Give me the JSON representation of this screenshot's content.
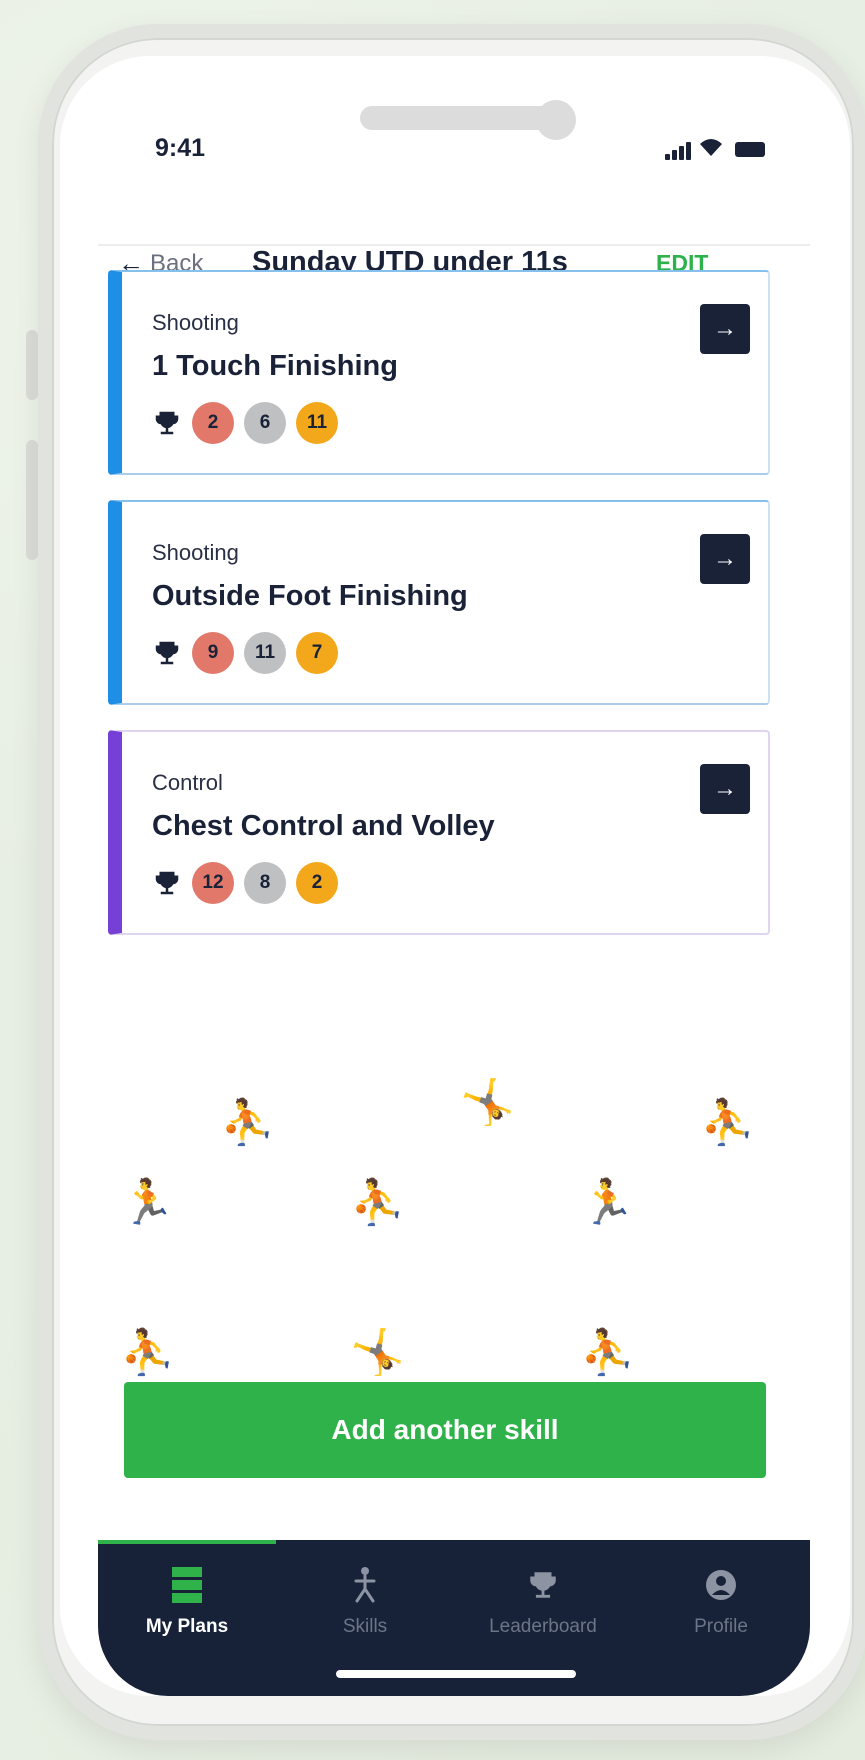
{
  "status_bar": {
    "time": "9:41"
  },
  "header": {
    "back_label": "Back",
    "title": "Sunday UTD under 11s",
    "edit_label": "EDIT"
  },
  "skills": [
    {
      "category": "Shooting",
      "name": "1 Touch Finishing",
      "badges": [
        "2",
        "6",
        "11"
      ],
      "accent": "#1f8fe6"
    },
    {
      "category": "Shooting",
      "name": "Outside Foot Finishing",
      "badges": [
        "9",
        "11",
        "7"
      ],
      "accent": "#1f8fe6"
    },
    {
      "category": "Control",
      "name": "Chest Control and Volley",
      "badges": [
        "12",
        "8",
        "2"
      ],
      "accent": "#7640d6"
    }
  ],
  "cta": {
    "label": "Add another skill"
  },
  "tabs": [
    {
      "label": "My Plans",
      "icon": "plans-icon",
      "active": true
    },
    {
      "label": "Skills",
      "icon": "skills-icon",
      "active": false
    },
    {
      "label": "Leaderboard",
      "icon": "trophy-icon",
      "active": false
    },
    {
      "label": "Profile",
      "icon": "profile-icon",
      "active": false
    }
  ],
  "colors": {
    "primary_green": "#2fb24a",
    "navy": "#172238",
    "badge_red": "#e2786a",
    "badge_grey": "#bfc0c2",
    "badge_gold": "#f3a81c"
  }
}
